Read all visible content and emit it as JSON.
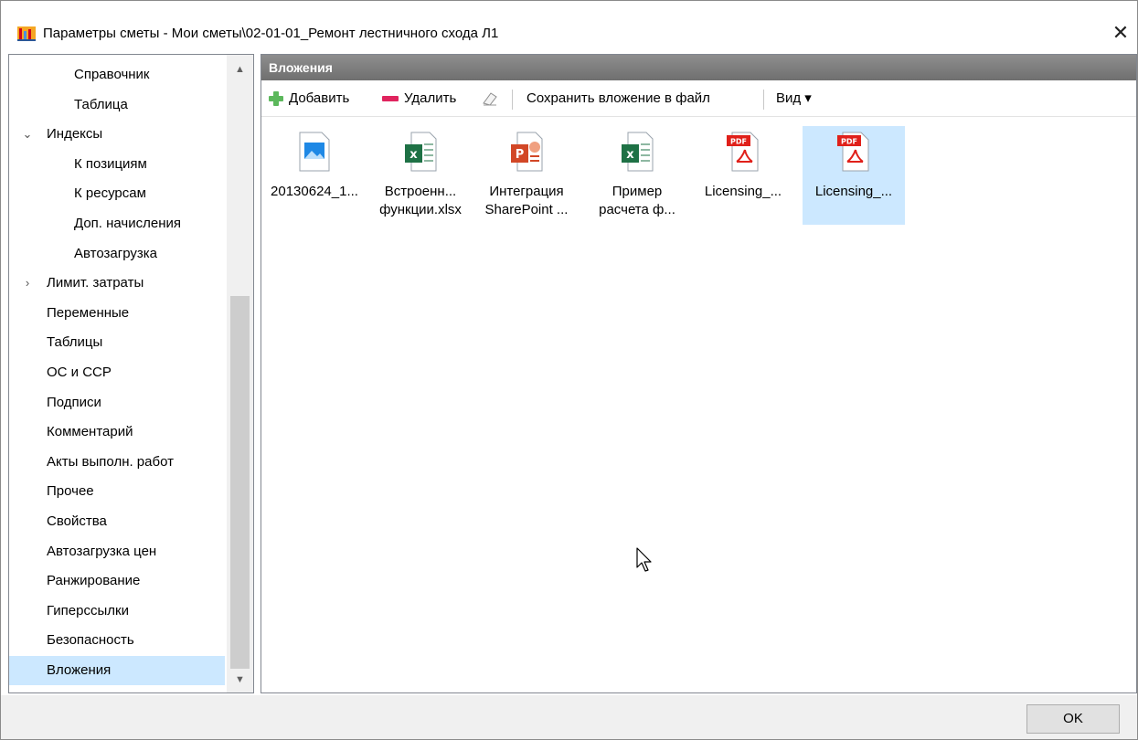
{
  "window": {
    "title": "Параметры сметы - Мои сметы\\02-01-01_Ремонт лестничного схода Л1",
    "close_label": "✕"
  },
  "nav": {
    "items": [
      {
        "label": "Справочник",
        "indent": 2
      },
      {
        "label": "Таблица",
        "indent": 2
      },
      {
        "label": "Индексы",
        "indent": 1,
        "chevron": "⌄"
      },
      {
        "label": "К позициям",
        "indent": 2
      },
      {
        "label": "К ресурсам",
        "indent": 2
      },
      {
        "label": "Доп. начисления",
        "indent": 2
      },
      {
        "label": "Автозагрузка",
        "indent": 2
      },
      {
        "label": "Лимит. затраты",
        "indent": 1,
        "chevron": "›"
      },
      {
        "label": "Переменные",
        "indent": 1
      },
      {
        "label": "Таблицы",
        "indent": 1
      },
      {
        "label": "ОС и ССР",
        "indent": 1
      },
      {
        "label": "Подписи",
        "indent": 1
      },
      {
        "label": "Комментарий",
        "indent": 1
      },
      {
        "label": "Акты выполн. работ",
        "indent": 1
      },
      {
        "label": "Прочее",
        "indent": 1
      },
      {
        "label": "Свойства",
        "indent": 1
      },
      {
        "label": "Автозагрузка цен",
        "indent": 1
      },
      {
        "label": "Ранжирование",
        "indent": 1
      },
      {
        "label": "Гиперссылки",
        "indent": 1
      },
      {
        "label": "Безопасность",
        "indent": 1
      },
      {
        "label": "Вложения",
        "indent": 1,
        "selected": true
      }
    ],
    "scroll_up": "▲",
    "scroll_down": "▼"
  },
  "content": {
    "header": "Вложения",
    "toolbar": {
      "add_label": "Добавить",
      "delete_label": "Удалить",
      "save_label": "Сохранить вложение в файл",
      "view_label": "Вид ▾"
    },
    "files": [
      {
        "type": "image",
        "line1": "20130624_1...",
        "line2": ""
      },
      {
        "type": "excel",
        "line1": "Встроенн...",
        "line2": "функции.xlsx"
      },
      {
        "type": "powerpoint",
        "line1": "Интеграция",
        "line2": "SharePoint ..."
      },
      {
        "type": "excel",
        "line1": "Пример",
        "line2": "расчета ф..."
      },
      {
        "type": "pdf",
        "line1": "Licensing_...",
        "line2": ""
      },
      {
        "type": "pdf",
        "line1": "Licensing_...",
        "line2": "",
        "selected": true
      }
    ],
    "pdf_badge": "PDF"
  },
  "footer": {
    "ok_label": "OK"
  },
  "colors": {
    "selection": "#cce8ff",
    "excel": "#1e7145",
    "powerpoint": "#d24726",
    "pdf": "#e0201a",
    "add_green": "#5cb85c",
    "delete_red": "#e0245e"
  }
}
